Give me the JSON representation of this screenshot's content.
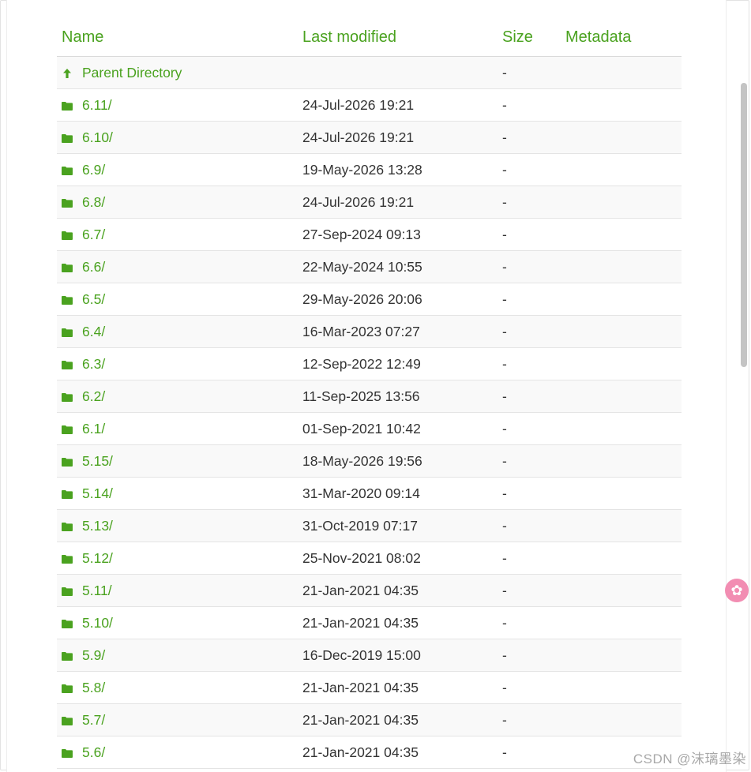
{
  "colors": {
    "link": "#4aa21f",
    "text": "#333333",
    "stripe": "#f9f9f9",
    "badge": "#f28db2"
  },
  "table": {
    "headers": {
      "name": "Name",
      "last_modified": "Last modified",
      "size": "Size",
      "metadata": "Metadata"
    },
    "parent": {
      "label": "Parent Directory",
      "size": "-",
      "icon": "arrow-up-icon"
    },
    "rows": [
      {
        "name": "6.11/",
        "modified": "24-Jul-2026 19:21",
        "size": "-",
        "icon": "folder-icon"
      },
      {
        "name": "6.10/",
        "modified": "24-Jul-2026 19:21",
        "size": "-",
        "icon": "folder-icon"
      },
      {
        "name": "6.9/",
        "modified": "19-May-2026 13:28",
        "size": "-",
        "icon": "folder-icon"
      },
      {
        "name": "6.8/",
        "modified": "24-Jul-2026 19:21",
        "size": "-",
        "icon": "folder-icon"
      },
      {
        "name": "6.7/",
        "modified": "27-Sep-2024 09:13",
        "size": "-",
        "icon": "folder-icon"
      },
      {
        "name": "6.6/",
        "modified": "22-May-2024 10:55",
        "size": "-",
        "icon": "folder-icon"
      },
      {
        "name": "6.5/",
        "modified": "29-May-2026 20:06",
        "size": "-",
        "icon": "folder-icon"
      },
      {
        "name": "6.4/",
        "modified": "16-Mar-2023 07:27",
        "size": "-",
        "icon": "folder-icon"
      },
      {
        "name": "6.3/",
        "modified": "12-Sep-2022 12:49",
        "size": "-",
        "icon": "folder-icon"
      },
      {
        "name": "6.2/",
        "modified": "11-Sep-2025 13:56",
        "size": "-",
        "icon": "folder-icon"
      },
      {
        "name": "6.1/",
        "modified": "01-Sep-2021 10:42",
        "size": "-",
        "icon": "folder-icon"
      },
      {
        "name": "5.15/",
        "modified": "18-May-2026 19:56",
        "size": "-",
        "icon": "folder-icon"
      },
      {
        "name": "5.14/",
        "modified": "31-Mar-2020 09:14",
        "size": "-",
        "icon": "folder-icon"
      },
      {
        "name": "5.13/",
        "modified": "31-Oct-2019 07:17",
        "size": "-",
        "icon": "folder-icon"
      },
      {
        "name": "5.12/",
        "modified": "25-Nov-2021 08:02",
        "size": "-",
        "icon": "folder-icon"
      },
      {
        "name": "5.11/",
        "modified": "21-Jan-2021 04:35",
        "size": "-",
        "icon": "folder-icon"
      },
      {
        "name": "5.10/",
        "modified": "21-Jan-2021 04:35",
        "size": "-",
        "icon": "folder-icon"
      },
      {
        "name": "5.9/",
        "modified": "16-Dec-2019 15:00",
        "size": "-",
        "icon": "folder-icon"
      },
      {
        "name": "5.8/",
        "modified": "21-Jan-2021 04:35",
        "size": "-",
        "icon": "folder-icon"
      },
      {
        "name": "5.7/",
        "modified": "21-Jan-2021 04:35",
        "size": "-",
        "icon": "folder-icon"
      },
      {
        "name": "5.6/",
        "modified": "21-Jan-2021 04:35",
        "size": "-",
        "icon": "folder-icon"
      }
    ]
  },
  "watermark": "CSDN @沫璃墨染"
}
